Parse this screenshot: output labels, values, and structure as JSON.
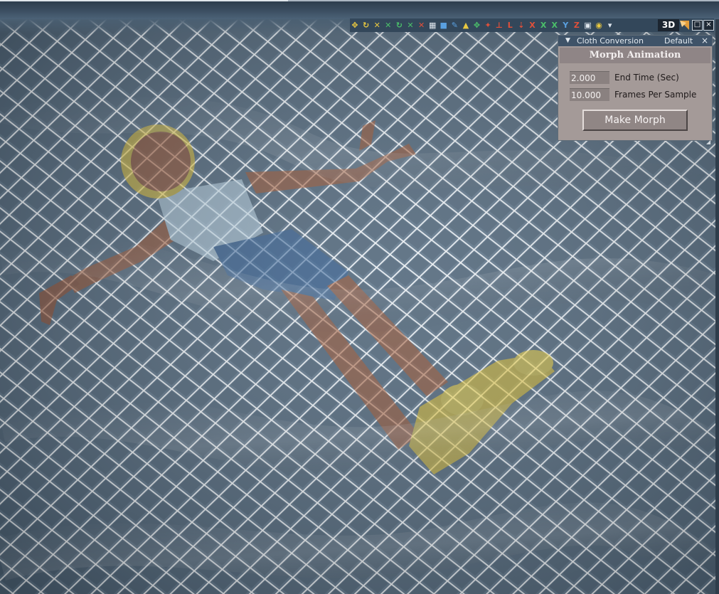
{
  "toolbar": {
    "tools": [
      {
        "icon": "move-icon",
        "color": "yellow",
        "glyph": "✥"
      },
      {
        "icon": "rotate-icon",
        "color": "yellow",
        "glyph": "↻"
      },
      {
        "icon": "scale-icon",
        "color": "yellow",
        "glyph": "✕"
      },
      {
        "icon": "translate-x-icon",
        "color": "green",
        "glyph": "✕"
      },
      {
        "icon": "twist-icon",
        "color": "green",
        "glyph": "↻"
      },
      {
        "icon": "taper-icon",
        "color": "green",
        "glyph": "✕"
      },
      {
        "icon": "chain-break-icon",
        "color": "red",
        "glyph": "✕"
      },
      {
        "icon": "grid-icon",
        "color": "white",
        "glyph": "▦"
      },
      {
        "icon": "cube-icon",
        "color": "blue",
        "glyph": "■"
      },
      {
        "icon": "brush-icon",
        "color": "blue",
        "glyph": "✎"
      },
      {
        "icon": "cone-icon",
        "color": "yellow",
        "glyph": "▲"
      },
      {
        "icon": "lasso-icon",
        "color": "green",
        "glyph": "✥"
      },
      {
        "icon": "joint-icon",
        "color": "red",
        "glyph": "✦"
      },
      {
        "icon": "axes-icon",
        "color": "red",
        "glyph": "⊥"
      },
      {
        "icon": "axis-l-icon",
        "color": "red",
        "glyph": "L"
      },
      {
        "icon": "down-arrow-icon",
        "color": "red",
        "glyph": "⇣"
      },
      {
        "icon": "axis-x-red-icon",
        "color": "red",
        "glyph": "X"
      },
      {
        "icon": "axis-x-icon",
        "color": "green",
        "glyph": "X"
      },
      {
        "icon": "axis-x-green-icon",
        "color": "green",
        "glyph": "X"
      },
      {
        "icon": "axis-y-icon",
        "color": "blue",
        "glyph": "Y"
      },
      {
        "icon": "axis-z-icon",
        "color": "red",
        "glyph": "Z"
      },
      {
        "icon": "camera-icon",
        "color": "white",
        "glyph": "▣"
      },
      {
        "icon": "render-icon",
        "color": "yellow",
        "glyph": "◉"
      },
      {
        "icon": "dropdown-icon",
        "color": "white",
        "glyph": "▾"
      }
    ],
    "view_mode_label": "3D"
  },
  "colors": {
    "panel_bg": "#a49a98",
    "panel_header": "#3f5368",
    "cloth_grid": "#e8eef4",
    "figure_skin": "#a0512a",
    "shirt": "#b9d3e3",
    "shorts": "#2f5e96",
    "floatie": "#e3c22a"
  },
  "panel": {
    "header_title": "Cloth Conversion",
    "preset": "Default",
    "close_glyph": "×",
    "title": "Morph Animation",
    "end_time_value": "2.000",
    "end_time_label": "End Time (Sec)",
    "frames_value": "10.000",
    "frames_label": "Frames Per Sample",
    "make_morph_label": "Make Morph"
  }
}
